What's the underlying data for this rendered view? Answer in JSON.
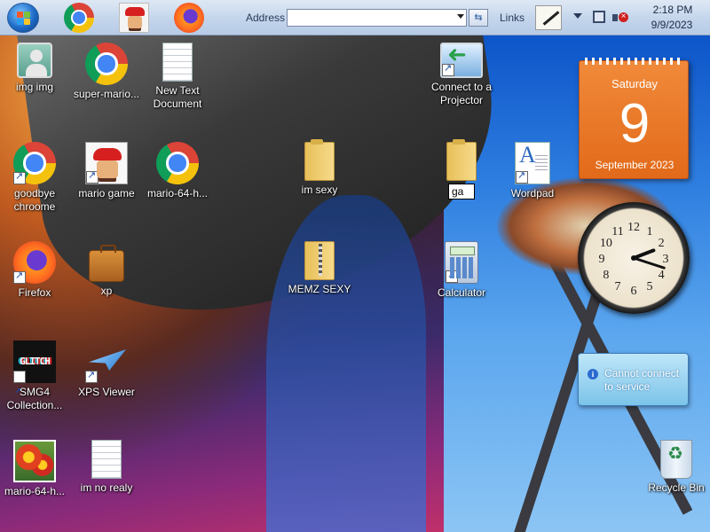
{
  "taskbar": {
    "address_label": "Address",
    "address_value": "",
    "links_label": "Links",
    "time": "2:18 PM",
    "date": "9/9/2023",
    "pinned": [
      {
        "name": "Google Chrome",
        "icon": "chrome-icon"
      },
      {
        "name": "Mario",
        "icon": "mario-icon"
      },
      {
        "name": "Firefox",
        "icon": "firefox-icon"
      }
    ]
  },
  "desktop": {
    "icons": {
      "img_img": "img img",
      "super_mario": "super-mario...",
      "new_text_document": "New Text Document",
      "connect_projector": "Connect to a Projector",
      "goodbye_chroome": "goodbye chroome",
      "mario_game": "mario game",
      "mario_64_h_1": "mario-64-h...",
      "im_sexy": "im sexy",
      "rename_value": "ga",
      "wordpad": "Wordpad",
      "firefox": "Firefox",
      "xp": "xp",
      "memz_sexy": "MEMZ SEXY",
      "calculator": "Calculator",
      "smg4": "SMG4 Collection...",
      "glitch_text": "GLITCH",
      "xps_viewer": "XPS Viewer",
      "mario_64_h_2": "mario-64-h...",
      "im_no_realy": "im no realy",
      "recycle_bin": "Recycle Bin"
    }
  },
  "calendar": {
    "weekday": "Saturday",
    "day": "9",
    "month_year": "September 2023"
  },
  "clock_gadget": {
    "hour": 2,
    "minute": 18,
    "numerals": [
      "12",
      "1",
      "2",
      "3",
      "4",
      "5",
      "6",
      "7",
      "8",
      "9",
      "10",
      "11"
    ]
  },
  "notification": {
    "message": "Cannot connect to service"
  },
  "colors": {
    "calendar_orange": "#e8761f",
    "taskbar": "#c9d8ec",
    "balloon": "#8fcdee"
  }
}
